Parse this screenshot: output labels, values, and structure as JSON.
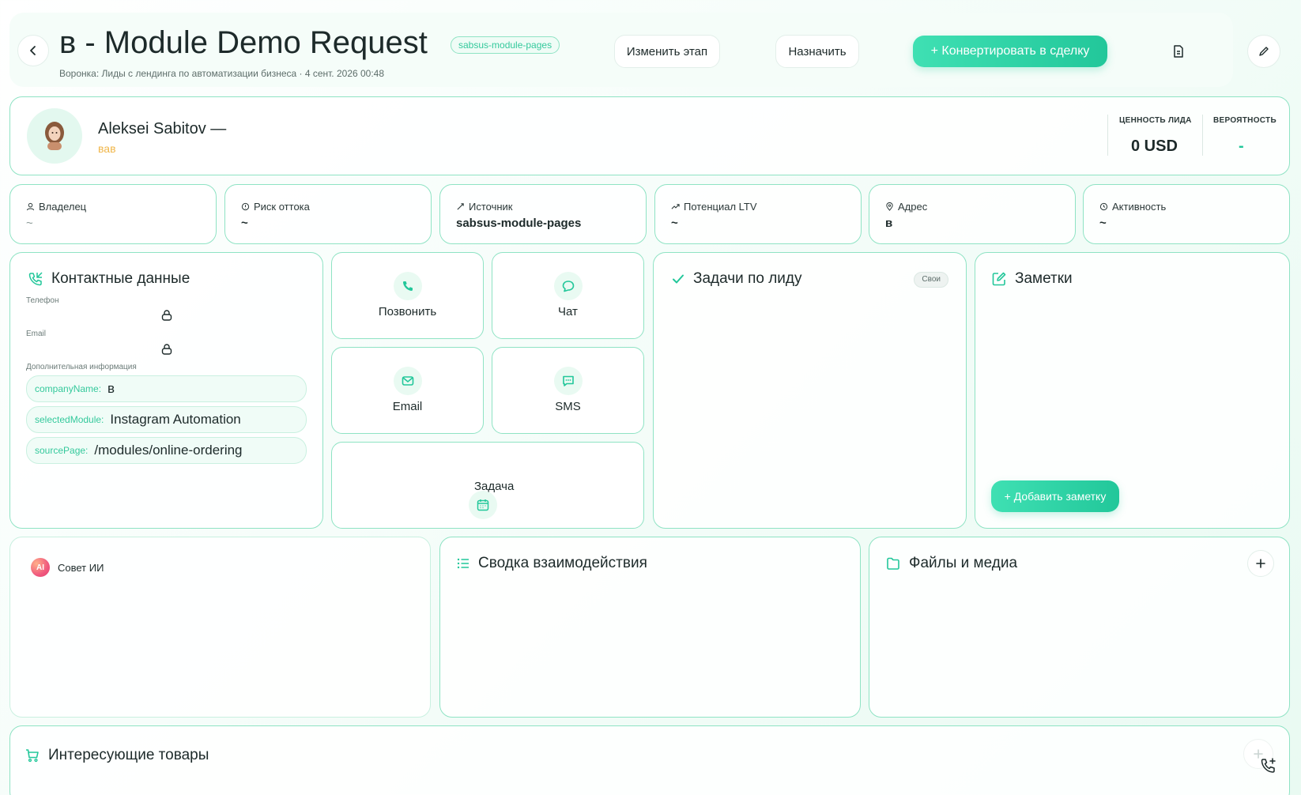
{
  "header": {
    "title": "в - Module Demo Request",
    "source_tag": "sabsus-module-pages",
    "subtitle": "Воронка: Лиды с лендинга по автоматизации бизнеса · 4 сент. 2026 00:48",
    "change_stage_label": "Изменить этап",
    "assign_label": "Назначить",
    "convert_label": "+ Конвертировать в сделку"
  },
  "contact": {
    "name": "Aleksei Sabitov —",
    "company": "вав",
    "value_label": "ЦЕННОСТЬ ЛИДА",
    "value": "0 USD",
    "probability_label": "ВЕРОЯТНОСТЬ",
    "probability": "-"
  },
  "info_cards": [
    {
      "label": "Владелец",
      "value": "~",
      "icon": "user-icon"
    },
    {
      "label": "Риск оттока",
      "value": "~",
      "icon": "alert-icon"
    },
    {
      "label": "Источник",
      "value": "sabsus-module-pages",
      "icon": "source-icon"
    },
    {
      "label": "Потенциал LTV",
      "value": "~",
      "icon": "trend-icon"
    },
    {
      "label": "Адрес",
      "value": "в",
      "icon": "pin-icon"
    },
    {
      "label": "Активность",
      "value": "~",
      "icon": "clock-icon"
    }
  ],
  "contact_data": {
    "title": "Контактные данные",
    "phone_label": "Телефон",
    "email_label": "Email",
    "extra_label": "Дополнительная информация",
    "fields": [
      {
        "key": "companyName:",
        "value": "в"
      },
      {
        "key": "selectedModule:",
        "value": "Instagram Automation"
      },
      {
        "key": "sourcePage:",
        "value": "/modules/online-ordering"
      }
    ]
  },
  "actions": {
    "call": "Позвонить",
    "chat": "Чат",
    "email": "Email",
    "sms": "SMS",
    "task": "Задача"
  },
  "tasks": {
    "title": "Задачи по лиду",
    "filter": "Свои"
  },
  "notes": {
    "title": "Заметки",
    "add_label": "+ Добавить заметку"
  },
  "ai": {
    "badge": "AI",
    "title": "Совет ИИ"
  },
  "summary": {
    "title": "Сводка взаимодействия"
  },
  "files": {
    "title": "Файлы и медиа"
  },
  "products": {
    "title": "Интересующие товары"
  },
  "colors": {
    "accent": "#22c79a",
    "border": "#8fe3c4",
    "company": "#f0b64a"
  }
}
